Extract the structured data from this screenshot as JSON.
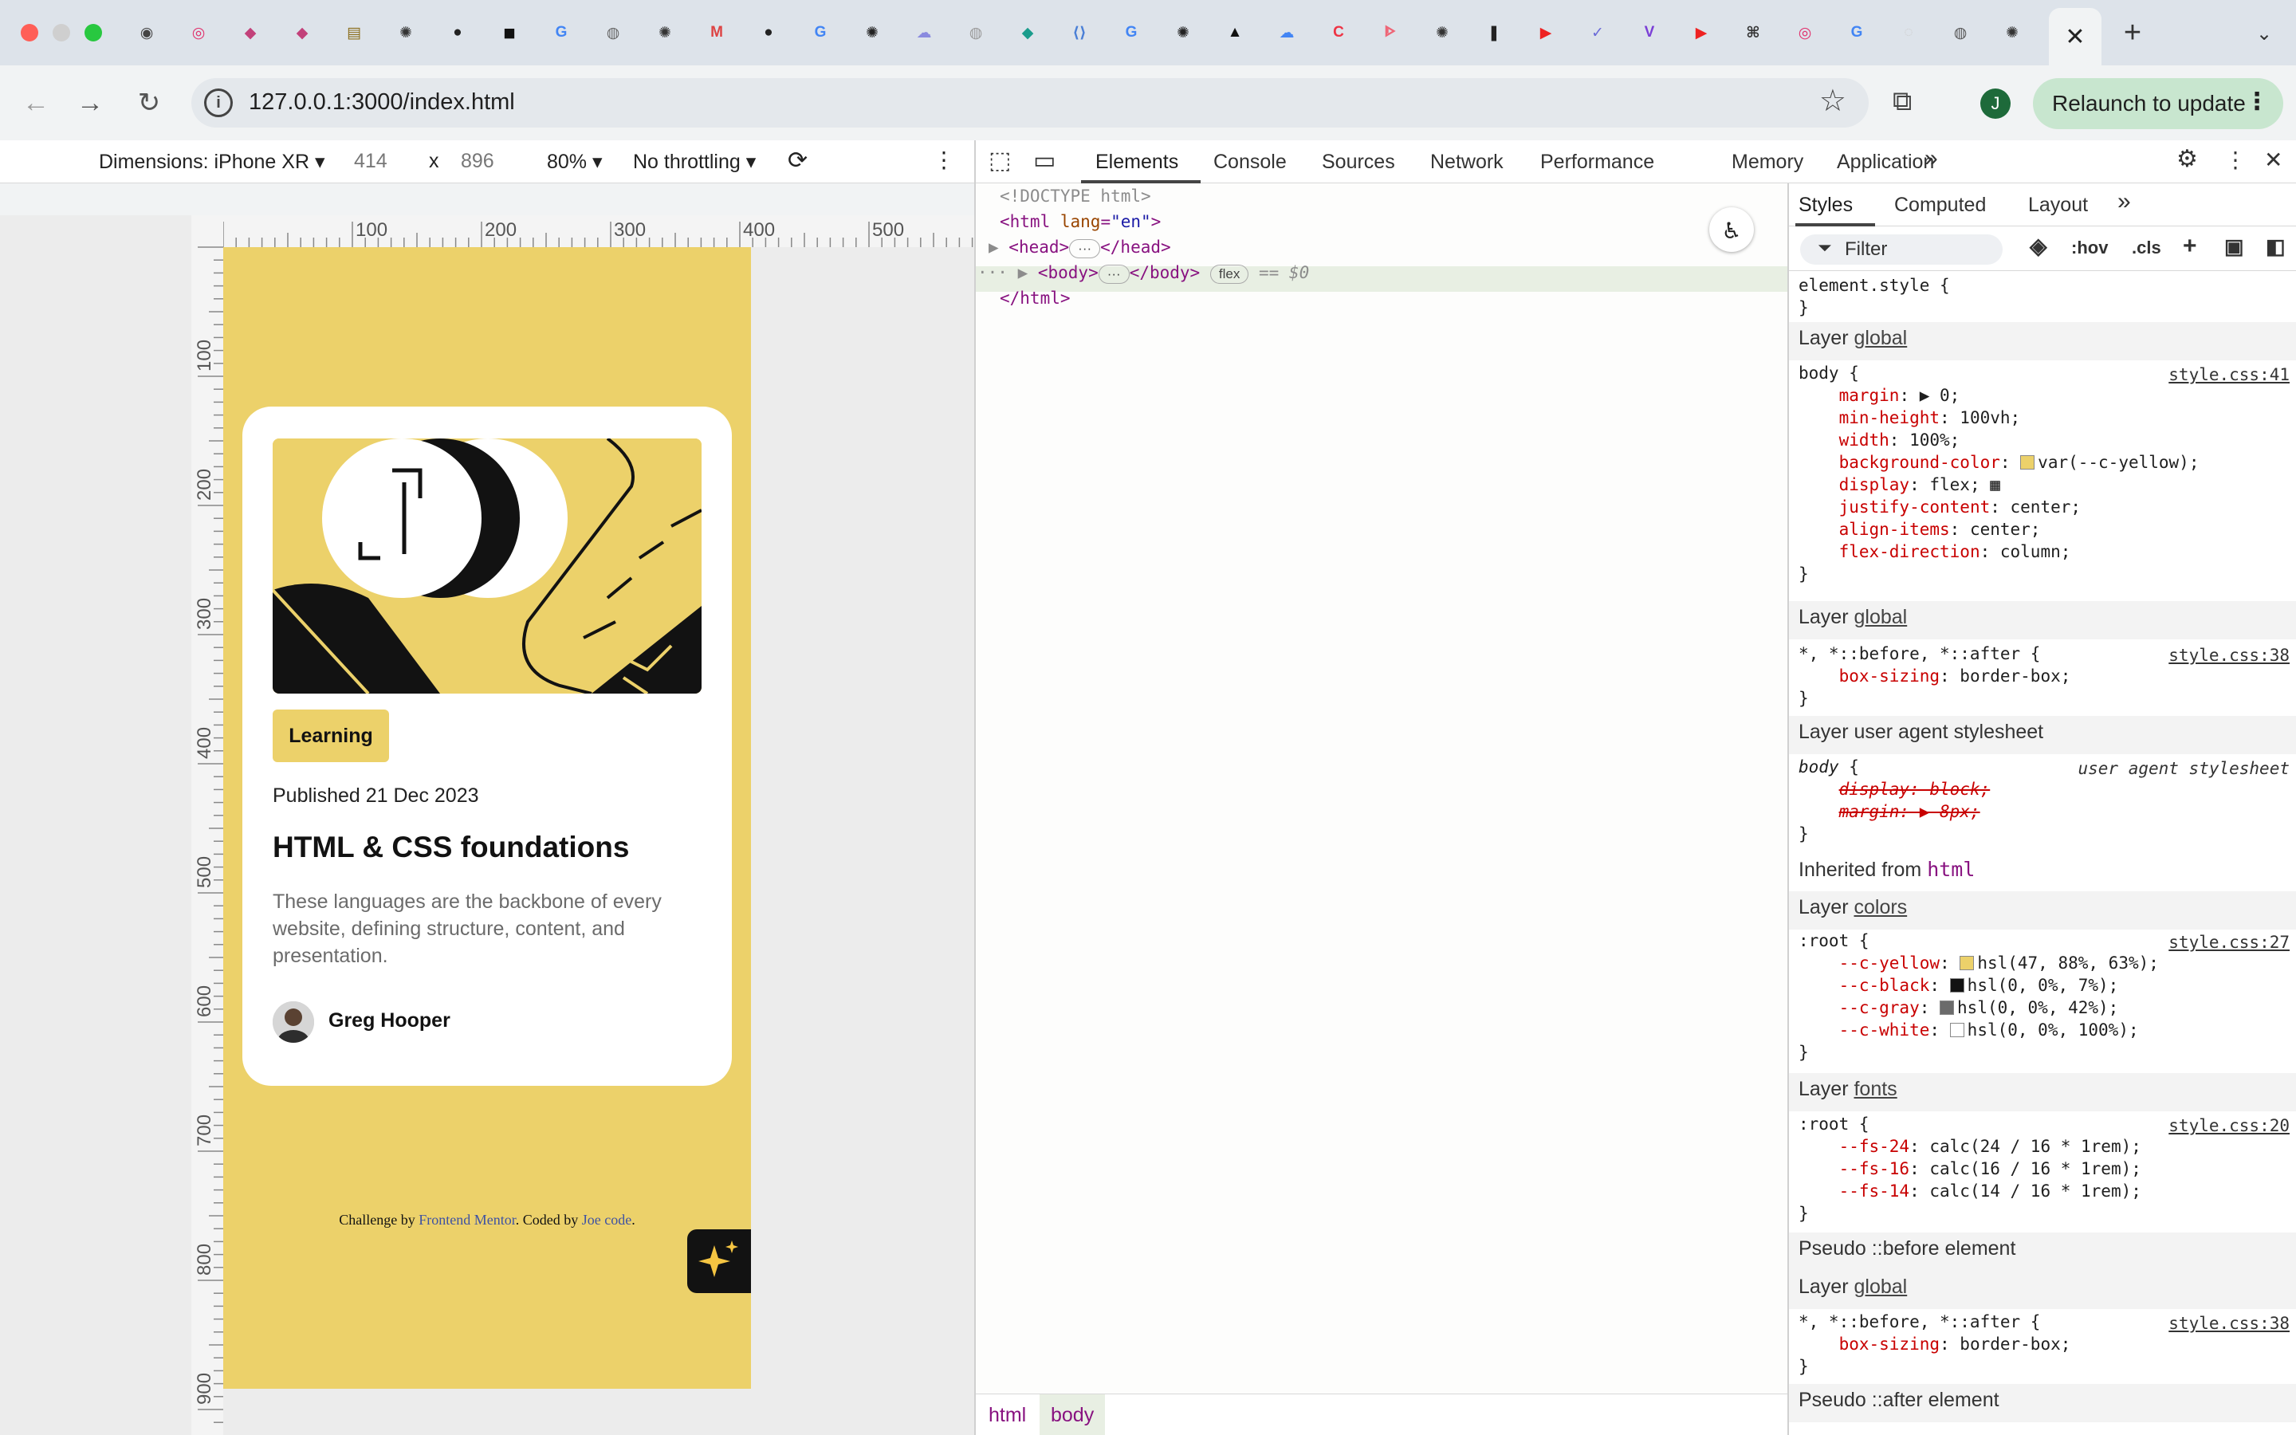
{
  "browser": {
    "active_tab_close": "✕",
    "new_tab": "+",
    "url": "127.0.0.1:3000/index.html",
    "relaunch_label": "Relaunch to update",
    "profile_initial": "J"
  },
  "device_toolbar": {
    "dimensions_label": "Dimensions: iPhone XR",
    "width": "414",
    "times": "x",
    "height": "896",
    "zoom": "80%",
    "throttling": "No throttling"
  },
  "rulers": {
    "top_ticks": [
      "100",
      "200",
      "300",
      "400",
      "500"
    ],
    "left_ticks": [
      "100",
      "200",
      "300",
      "400",
      "500",
      "600",
      "700",
      "800",
      "900"
    ]
  },
  "card": {
    "tag": "Learning",
    "published": "Published 21 Dec 2023",
    "title": "HTML & CSS foundations",
    "description": "These languages are the backbone of every website, defining structure, content, and presentation.",
    "author": "Greg Hooper"
  },
  "attribution": {
    "prefix": "Challenge by ",
    "fm_link": "Frontend Mentor",
    "middle": ". Coded by ",
    "joe_link": "Joe code",
    "suffix": "."
  },
  "devtools": {
    "tabs": [
      "Elements",
      "Console",
      "Sources",
      "Network",
      "Performance",
      "Memory",
      "Application"
    ],
    "more": "»",
    "dom": {
      "doctype": "<!DOCTYPE html>",
      "html_open": "<html",
      "lang_attr": " lang",
      "lang_val": "\"en\"",
      "head": "<head>",
      "head_close": "</head>",
      "body": "<body>",
      "body_close": "</body>",
      "flex_badge": "flex",
      "sel_marker": "== $0",
      "html_close": "</html>",
      "ellipsis": "···"
    },
    "breadcrumbs": [
      "html",
      "body"
    ],
    "styles_tabs": [
      "Styles",
      "Computed",
      "Layout"
    ],
    "filter_placeholder": "Filter",
    "hov": ":hov",
    "cls": ".cls",
    "colors": {
      "yellow": "#ecd16a",
      "black": "#121212",
      "gray": "#6b6b6b",
      "white": "#ffffff"
    }
  }
}
